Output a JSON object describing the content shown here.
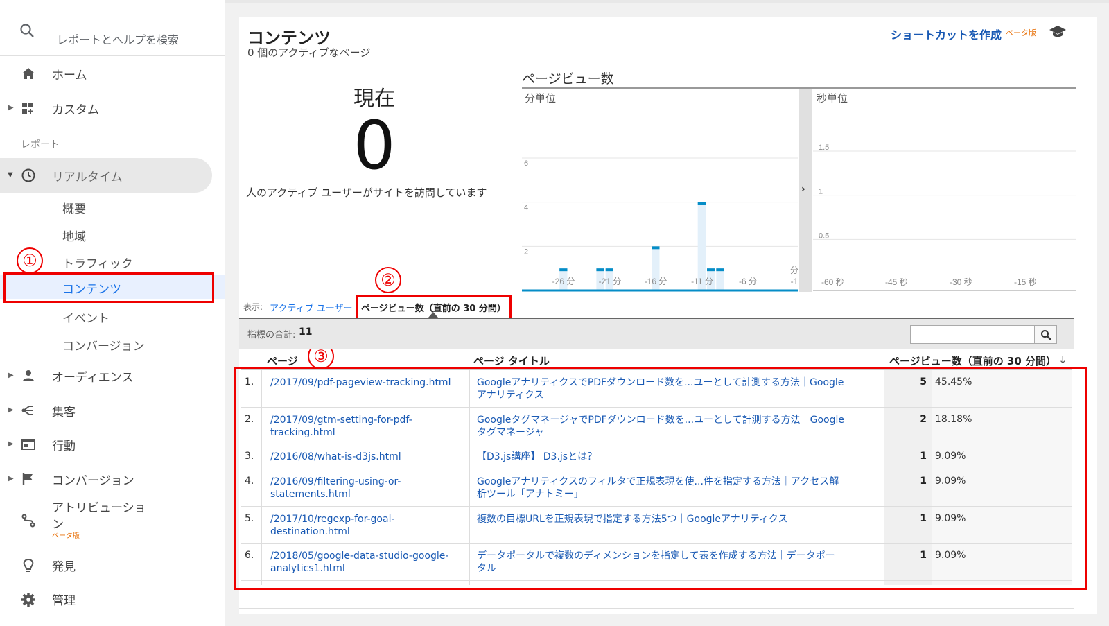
{
  "search": {
    "placeholder": "レポートとヘルプを検索"
  },
  "sidebar": {
    "home": "ホーム",
    "custom": "カスタム",
    "reports_header": "レポート",
    "realtime": "リアルタイム",
    "realtime_items": [
      "概要",
      "地域",
      "トラフィック",
      "コンテンツ",
      "イベント",
      "コンバージョン"
    ],
    "audience": "オーディエンス",
    "acquisition": "集客",
    "behavior": "行動",
    "conversion": "コンバージョン",
    "attribution_l1": "アトリビューショ",
    "attribution_l2": "ン",
    "attribution_beta": "ベータ版",
    "discover": "発見",
    "admin": "管理"
  },
  "header": {
    "title": "コンテンツ",
    "subtitle": "0 個のアクティブなページ",
    "shortcut": "ショートカットを作成",
    "beta": "ベータ版"
  },
  "now": {
    "label": "現在",
    "value": "0",
    "caption": "人のアクティブ ユーザーがサイトを訪問しています"
  },
  "chart": {
    "title": "ページビュー数",
    "minute_label": "分単位",
    "second_label": "秒単位"
  },
  "chart_data": [
    {
      "type": "bar",
      "title": "分単位",
      "ylabel": "",
      "yticks": [
        "2",
        "4",
        "6"
      ],
      "ylim": [
        0,
        6
      ],
      "xticks": [
        "-26 分",
        "-21 分",
        "-16 分",
        "-11 分",
        "-6 分",
        "分",
        "-1"
      ],
      "x": [
        -30,
        -29,
        -28,
        -27,
        -26,
        -25,
        -24,
        -23,
        -22,
        -21,
        -20,
        -19,
        -18,
        -17,
        -16,
        -15,
        -14,
        -13,
        -12,
        -11,
        -10,
        -9,
        -8,
        -7,
        -6,
        -5,
        -4,
        -3,
        -2,
        -1
      ],
      "values": [
        0,
        0,
        0,
        0,
        1,
        0,
        0,
        0,
        1,
        1,
        0,
        0,
        0,
        0,
        2,
        0,
        0,
        0,
        0,
        4,
        1,
        1,
        0,
        0,
        0,
        0,
        0,
        0,
        0,
        0
      ]
    },
    {
      "type": "bar",
      "title": "秒単位",
      "yticks": [
        "0.5",
        "1",
        "1.5"
      ],
      "ylim": [
        0,
        1.5
      ],
      "xticks": [
        "-60 秒",
        "-45 秒",
        "-30 秒",
        "-15 秒"
      ],
      "values": []
    }
  ],
  "tabs": {
    "show_label": "表示:",
    "active_users": "アクティブ ユーザー",
    "pageviews": "ページビュー数（直前の 30 分間）"
  },
  "summary": {
    "label": "指標の合計:",
    "value": "11"
  },
  "table": {
    "col_page": "ページ",
    "col_title": "ページ タイトル",
    "col_views": "ページビュー数（直前の 30 分間）",
    "rows": [
      {
        "num": "1.",
        "page_l1": "/2017/09/pdf-pageview-tracking.html",
        "page_l2": "",
        "title_l1": "GoogleアナリティクスでPDFダウンロード数を...ユーとして計測する方法｜Google",
        "title_l2": "アナリティクス",
        "count": "5",
        "pct": "45.45%"
      },
      {
        "num": "2.",
        "page_l1": "/2017/09/gtm-setting-for-pdf-",
        "page_l2": "tracking.html",
        "title_l1": "GoogleタグマネージャでPDFダウンロード数を...ユーとして計測する方法｜Google",
        "title_l2": "タグマネージャ",
        "count": "2",
        "pct": "18.18%"
      },
      {
        "num": "3.",
        "page_l1": "/2016/08/what-is-d3js.html",
        "page_l2": "",
        "title_l1": "【D3.js講座】 D3.jsとは？",
        "title_l2": "",
        "count": "1",
        "pct": "9.09%"
      },
      {
        "num": "4.",
        "page_l1": "/2016/09/filtering-using-or-",
        "page_l2": "statements.html",
        "title_l1": "Googleアナリティクスのフィルタで正規表現を使...件を指定する方法｜アクセス解",
        "title_l2": "析ツール「アナトミー」",
        "count": "1",
        "pct": "9.09%"
      },
      {
        "num": "5.",
        "page_l1": "/2017/10/regexp-for-goal-",
        "page_l2": "destination.html",
        "title_l1": "複数の目標URLを正規表現で指定する方法5つ｜Googleアナリティクス",
        "title_l2": "",
        "count": "1",
        "pct": "9.09%"
      },
      {
        "num": "6.",
        "page_l1": "/2018/05/google-data-studio-google-",
        "page_l2": "analytics1.html",
        "title_l1": "データポータルで複数のディメンションを指定して表を作成する方法｜データポー",
        "title_l2": "タル",
        "count": "1",
        "pct": "9.09%"
      }
    ]
  },
  "annotations": [
    "①",
    "②",
    "③"
  ],
  "colors": {
    "accent": "#1a73e8",
    "link": "#1a5ab4",
    "bar": "#058dc7",
    "bar_bg": "#e3f0fa",
    "highlight": "#e00000",
    "active_bg": "#e8f0fe"
  }
}
